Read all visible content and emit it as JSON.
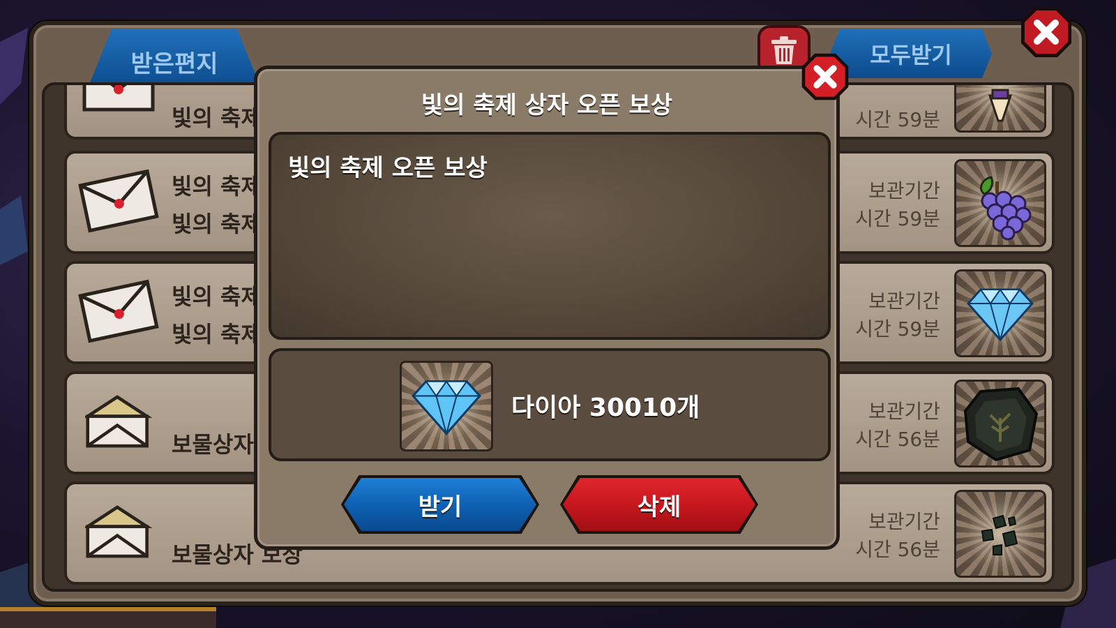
{
  "mailbox": {
    "tab_label": "받은편지",
    "receive_all_label": "모두받기",
    "rows": [
      {
        "title": "빛의 축제",
        "subtitle": "",
        "expiry_line1": "",
        "expiry_line2": "시간 59분",
        "item": "potion-icon"
      },
      {
        "title": "빛의 축제",
        "subtitle": "빛의 축제",
        "expiry_line1": "보관기간",
        "expiry_line2": "시간 59분",
        "item": "grape-icon"
      },
      {
        "title": "빛의 축제",
        "subtitle": "빛의 축제",
        "expiry_line1": "보관기간",
        "expiry_line2": "시간 59분",
        "item": "diamond-icon"
      },
      {
        "title": "보물상자",
        "subtitle": "",
        "expiry_line1": "보관기간",
        "expiry_line2": "시간 56분",
        "item": "dark-stone-icon"
      },
      {
        "title": "보물상자 보상",
        "subtitle": "",
        "expiry_line1": "보관기간",
        "expiry_line2": "시간 56분",
        "item": "ore-chunks-icon"
      }
    ]
  },
  "popup": {
    "title": "빛의 축제 상자 오픈 보상",
    "message": "빛의 축제 오픈 보상",
    "reward_text": "다이아 30010개",
    "reward_icon": "diamond-icon",
    "receive_label": "받기",
    "delete_label": "삭제"
  },
  "colors": {
    "accent_blue": "#0d5fb0",
    "accent_red": "#c4161c",
    "panel_brown": "#6d5e4f"
  }
}
